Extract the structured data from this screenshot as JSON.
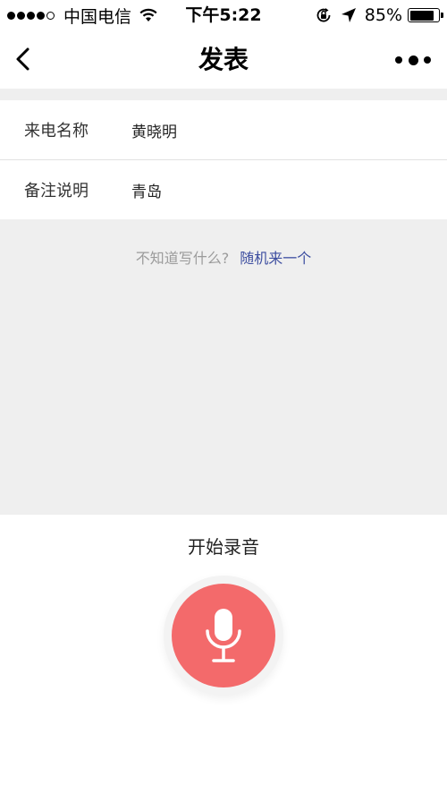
{
  "status_bar": {
    "carrier": "中国电信",
    "time": "下午5:22",
    "battery_percent": "85%",
    "battery_level": 0.85,
    "signal_bars_filled": 4,
    "signal_bars_total": 5
  },
  "nav": {
    "title": "发表",
    "back_icon": "chevron-left-icon",
    "more_icon": "more-dots-icon"
  },
  "form": {
    "fields": [
      {
        "label": "来电名称",
        "value": "黄晓明"
      },
      {
        "label": "备注说明",
        "value": "青岛"
      }
    ]
  },
  "content": {
    "hint_text": "不知道写什么?",
    "random_link": "随机来一个"
  },
  "record": {
    "label": "开始录音",
    "icon": "microphone-icon",
    "button_color": "#f36a6b"
  },
  "colors": {
    "accent_link": "#3d4ea0",
    "background_gray": "#efefef"
  }
}
